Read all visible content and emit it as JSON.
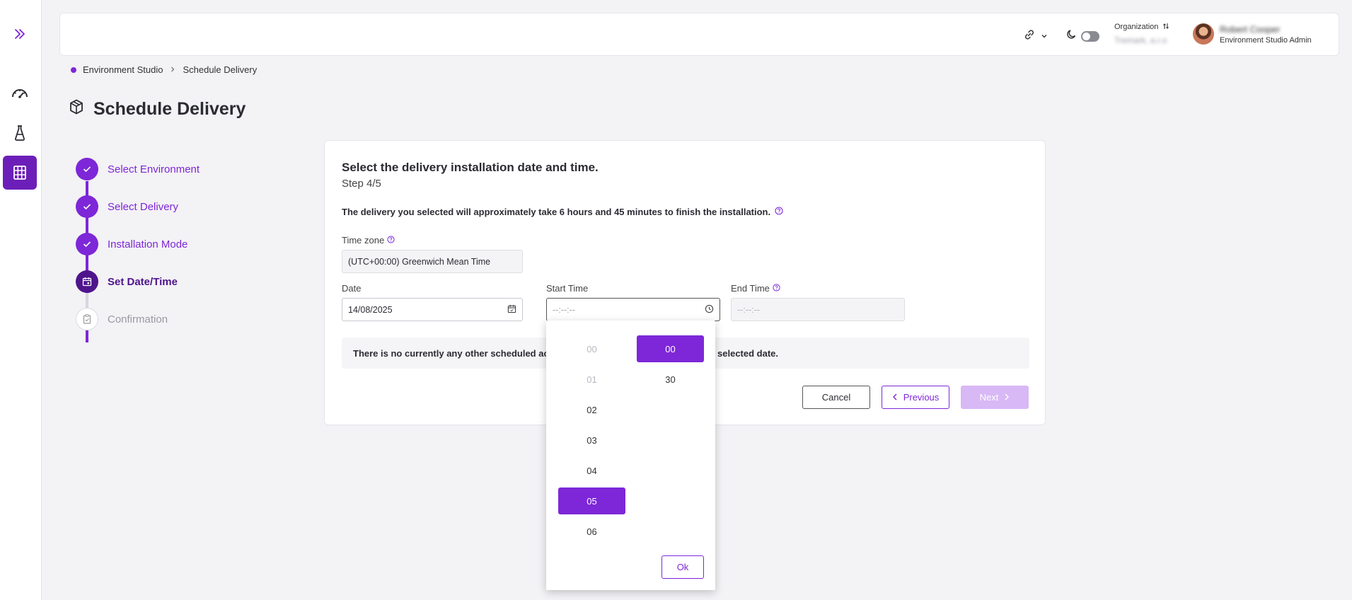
{
  "header": {
    "org_label": "Organization",
    "org_value": "Tremark, a.r.o",
    "user_name": "Robert Cooper",
    "user_role": "Environment Studio Admin"
  },
  "breadcrumb": {
    "root": "Environment Studio",
    "current": "Schedule Delivery"
  },
  "page_title": "Schedule Delivery",
  "steps": [
    {
      "label": "Select Environment",
      "status": "done"
    },
    {
      "label": "Select Delivery",
      "status": "done"
    },
    {
      "label": "Installation Mode",
      "status": "done"
    },
    {
      "label": "Set Date/Time",
      "status": "current"
    },
    {
      "label": "Confirmation",
      "status": "todo"
    }
  ],
  "card": {
    "title": "Select the delivery installation  date and time.",
    "step": "Step 4/5",
    "duration_text": "The delivery you selected will approximately take 6 hours and 45 minutes to finish the installation.",
    "timezone_label": "Time zone",
    "timezone_value": "(UTC+00:00) Greenwich Mean Time",
    "date_label": "Date",
    "date_value": "14/08/2025",
    "start_label": "Start Time",
    "start_placeholder": "--:--:--",
    "end_label": "End Time",
    "end_placeholder": "--:--:--",
    "notice_left": "There is no currently any other scheduled acti",
    "notice_right": "e selected date.",
    "cancel": "Cancel",
    "previous": "Previous",
    "next": "Next"
  },
  "time_picker": {
    "hours": [
      {
        "label": "00",
        "state": "muted"
      },
      {
        "label": "01",
        "state": "muted"
      },
      {
        "label": "02",
        "state": "normal"
      },
      {
        "label": "03",
        "state": "normal"
      },
      {
        "label": "04",
        "state": "normal"
      },
      {
        "label": "05",
        "state": "selected"
      },
      {
        "label": "06",
        "state": "normal"
      }
    ],
    "minutes": [
      {
        "label": "00",
        "state": "selected"
      },
      {
        "label": "30",
        "state": "normal"
      }
    ],
    "ok": "Ok"
  },
  "colors": {
    "accent": "#7d27d8",
    "accent_dark": "#4e148c",
    "accent_disabled": "#d8b8f5"
  }
}
